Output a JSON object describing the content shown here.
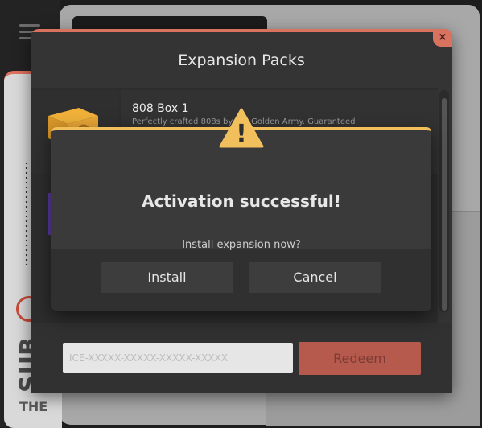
{
  "dialog": {
    "title": "Expansion Packs",
    "close_icon": "×"
  },
  "list": {
    "items": [
      {
        "title": "808 Box 1",
        "description": "Perfectly crafted 808s by the Golden Army. Guaranteed",
        "icon": "box-icon"
      }
    ]
  },
  "redeem": {
    "placeholder": "ICE-XXXXX-XXXXX-XXXXX-XXXXX",
    "button_label": "Redeem"
  },
  "alert": {
    "title": "Activation successful!",
    "question": "Install expansion now?",
    "install_label": "Install",
    "cancel_label": "Cancel",
    "icon": "warning-icon",
    "icon_glyph": "!"
  },
  "background": {
    "vertical_text": "SUB",
    "footer_text": "THE"
  },
  "colors": {
    "accent": "#d9735f",
    "alert_accent": "#f1c05c",
    "dialog_bg": "#343434"
  }
}
